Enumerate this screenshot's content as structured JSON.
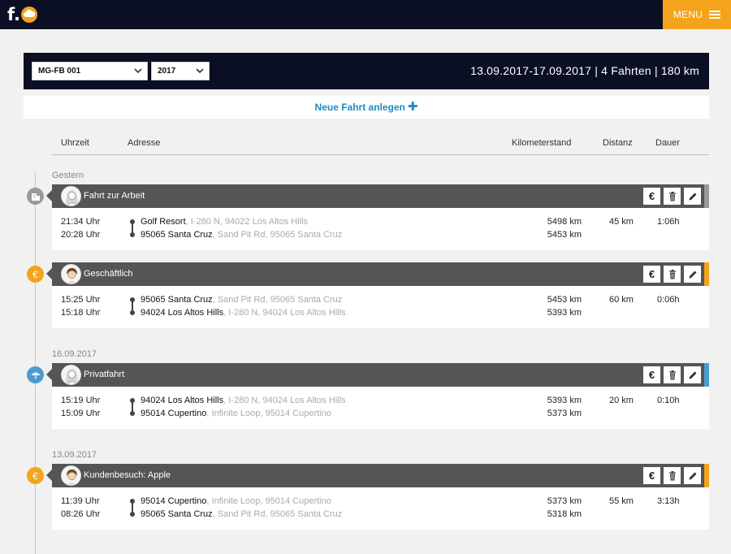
{
  "header": {
    "logo_letter": "f.",
    "menu_label": "MENU",
    "colors": {
      "navy": "#0a0f24",
      "orange": "#f5a21c",
      "blue": "#4a9cd0",
      "gray": "#999999"
    }
  },
  "filters": {
    "vehicle": "MG-FB 001",
    "year": "2017",
    "summary": "13.09.2017-17.09.2017 | 4 Fahrten | 180 km"
  },
  "new_trip": {
    "label": "Neue Fahrt anlegen",
    "icon": "plus-icon"
  },
  "columns": {
    "time": "Uhrzeit",
    "address": "Adresse",
    "odometer": "Kilometerstand",
    "distance": "Distanz",
    "duration": "Dauer"
  },
  "groups": [
    {
      "date": "Gestern"
    },
    {
      "date": "16.09.2017"
    },
    {
      "date": "13.09.2017"
    }
  ],
  "trips": [
    {
      "title": "Fahrt zur Arbeit",
      "category_icon": "building-icon",
      "rows": [
        {
          "time": "21:34 Uhr",
          "city": "Golf Resort",
          "street": ", I-280 N, 94022 Los Altos Hills",
          "km": "5498 km"
        },
        {
          "time": "20:28 Uhr",
          "city": "95065 Santa Cruz",
          "street": ", Sand Pit Rd, 95065 Santa Cruz",
          "km": "5453 km"
        }
      ],
      "distance": "45 km",
      "duration": "1:06h"
    },
    {
      "title": "Geschäftlich",
      "category_icon": "euro-icon",
      "rows": [
        {
          "time": "15:25 Uhr",
          "city": "95065 Santa Cruz",
          "street": ", Sand Pit Rd, 95065 Santa Cruz",
          "km": "5453 km"
        },
        {
          "time": "15:18 Uhr",
          "city": "94024 Los Altos Hills",
          "street": ", I-280 N, 94024 Los Altos Hills",
          "km": "5393 km"
        }
      ],
      "distance": "60 km",
      "duration": "0:06h"
    },
    {
      "title": "Privatfahrt",
      "category_icon": "umbrella-icon",
      "rows": [
        {
          "time": "15:19 Uhr",
          "city": "94024 Los Altos Hills",
          "street": ", I-280 N, 94024 Los Altos Hills",
          "km": "5393 km"
        },
        {
          "time": "15:09 Uhr",
          "city": "95014 Cupertino",
          "street": ", Infinite Loop, 95014 Cupertino",
          "km": "5373 km"
        }
      ],
      "distance": "20 km",
      "duration": "0:10h"
    },
    {
      "title": "Kundenbesuch: Apple",
      "category_icon": "euro-icon",
      "rows": [
        {
          "time": "11:39 Uhr",
          "city": "95014 Cupertino",
          "street": ", Infinite Loop, 95014 Cupertino",
          "km": "5373 km"
        },
        {
          "time": "08:26 Uhr",
          "city": "95065 Santa Cruz",
          "street": ", Sand Pit Rd, 95065 Santa Cruz",
          "km": "5318 km"
        }
      ],
      "distance": "55 km",
      "duration": "3:13h"
    }
  ],
  "action_labels": {
    "expense": "€"
  }
}
